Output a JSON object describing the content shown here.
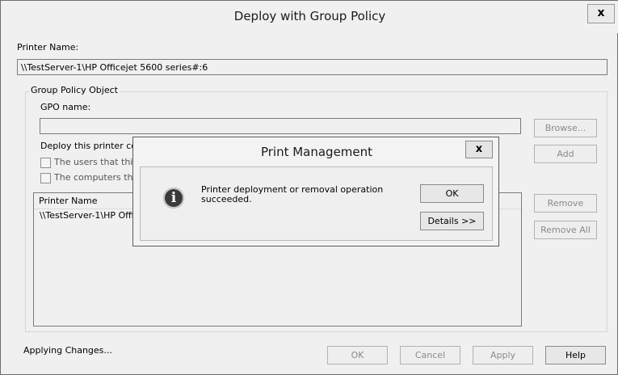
{
  "window": {
    "title": "Deploy with Group Policy",
    "close_label": "x"
  },
  "printer": {
    "label": "Printer Name:",
    "value": "\\\\TestServer-1\\HP Officejet 5600 series#:6"
  },
  "gpo": {
    "legend": "Group Policy Object",
    "name_label": "GPO name:",
    "name_value": "",
    "browse_label": "Browse...",
    "deploy_label": "Deploy this printer cor",
    "add_label": "Add",
    "check_users_label": "The users that this",
    "check_computers_label": "The computers tha",
    "list_header": "Printer Name",
    "list_rows": [
      "\\\\TestServer-1\\HP Offi"
    ],
    "remove_label": "Remove",
    "remove_all_label": "Remove All"
  },
  "footer": {
    "status": "Applying Changes...",
    "ok_label": "OK",
    "cancel_label": "Cancel",
    "apply_label": "Apply",
    "help_label": "Help"
  },
  "dialog": {
    "title": "Print Management",
    "close_label": "x",
    "icon": "info-icon",
    "message": "Printer deployment or removal operation succeeded.",
    "ok_label": "OK",
    "details_label": "Details >>"
  }
}
